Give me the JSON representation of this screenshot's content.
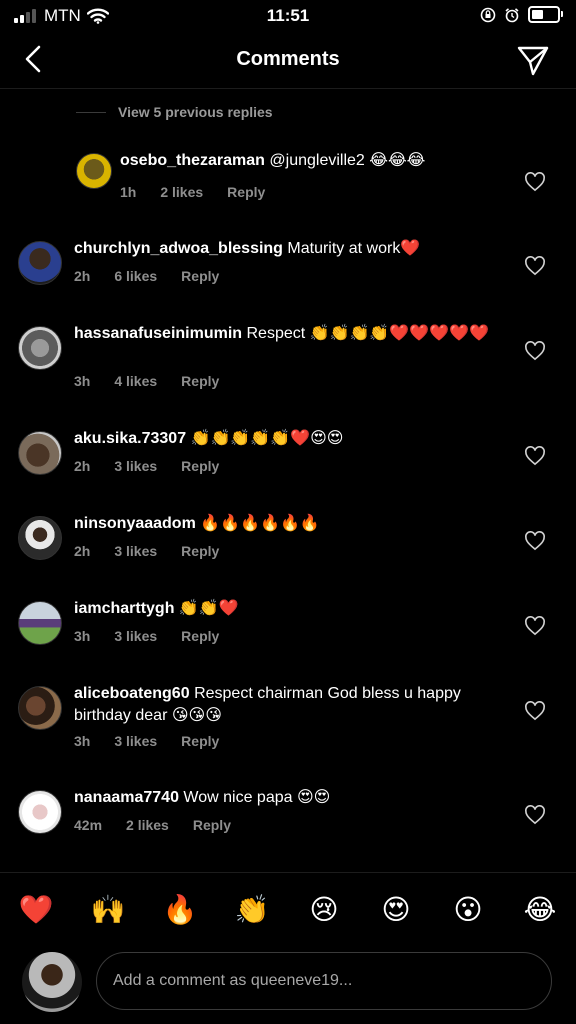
{
  "status": {
    "carrier": "MTN",
    "time": "11:51"
  },
  "header": {
    "title": "Comments"
  },
  "thread": {
    "view_replies": "View 5 previous replies"
  },
  "comments": [
    {
      "username": "osebo_thezaraman",
      "text": "@jungleville2 😂😂😂",
      "time": "1h",
      "likes": "2 likes",
      "reply": "Reply"
    },
    {
      "username": "churchlyn_adwoa_blessing",
      "text": "Maturity at work❤️",
      "time": "2h",
      "likes": "6 likes",
      "reply": "Reply"
    },
    {
      "username": "hassanafuseinimumin",
      "text": "Respect 👏👏👏👏❤️❤️❤️❤️❤️",
      "time": "3h",
      "likes": "4 likes",
      "reply": "Reply"
    },
    {
      "username": "aku.sika.73307",
      "text": "👏👏👏👏👏❤️😍😍",
      "time": "2h",
      "likes": "3 likes",
      "reply": "Reply"
    },
    {
      "username": "ninsonyaaadom",
      "text": "🔥🔥🔥🔥🔥🔥",
      "time": "2h",
      "likes": "3 likes",
      "reply": "Reply"
    },
    {
      "username": "iamcharttygh",
      "text": "👏👏❤️",
      "time": "3h",
      "likes": "3 likes",
      "reply": "Reply"
    },
    {
      "username": "aliceboateng60",
      "text": "Respect chairman God bless u happy birthday dear 😘😘😘",
      "time": "3h",
      "likes": "3 likes",
      "reply": "Reply"
    },
    {
      "username": "nanaama7740",
      "text": "Wow nice papa 😍😍",
      "time": "42m",
      "likes": "2 likes",
      "reply": "Reply"
    }
  ],
  "reactions": [
    "❤️",
    "🙌",
    "🔥",
    "👏",
    "😢",
    "😍",
    "😮",
    "😂"
  ],
  "composer": {
    "placeholder": "Add a comment as queeneve19..."
  },
  "colors": {
    "background": "#000000",
    "meta_text": "#8e8e8e",
    "border": "#3a3a3a"
  }
}
